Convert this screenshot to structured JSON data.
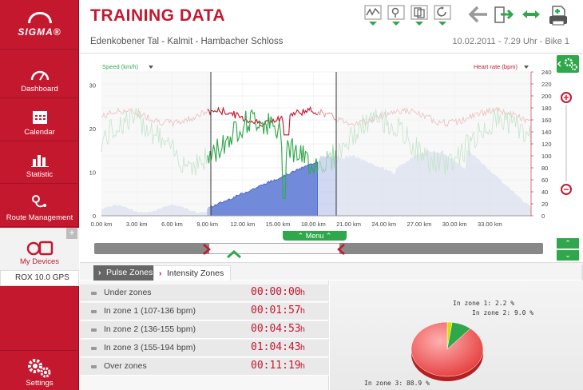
{
  "app": {
    "logo_text": "SIGMA®",
    "title": "TRAINING DATA"
  },
  "sidebar": {
    "items": [
      {
        "label": "Dashboard"
      },
      {
        "label": "Calendar"
      },
      {
        "label": "Statistic"
      },
      {
        "label": "Route Management"
      },
      {
        "label": "My Devices"
      },
      {
        "label": "Settings"
      }
    ],
    "add_label": "+",
    "device": "ROX 10.0 GPS"
  },
  "header": {
    "route": "Edenkobener Tal - Kalmit - Hambacher Schloss",
    "date_info": "10.02.2011 - 7.29 Uhr - Bike 1"
  },
  "chart": {
    "left_axis_label": "Speed (km/h)",
    "right_axis_label": "Heart rate (bpm)",
    "left_ticks": [
      "0",
      "10",
      "20",
      "30"
    ],
    "right_ticks": [
      "0",
      "20",
      "40",
      "60",
      "80",
      "100",
      "120",
      "140",
      "160",
      "180",
      "200",
      "220",
      "240"
    ],
    "x_ticks": [
      "0.00 km",
      "3.00 km",
      "6.00 km",
      "9.00 km",
      "12.00 km",
      "15.00 km",
      "18.00 km",
      "21.00 km",
      "24.00 km",
      "27.00 km",
      "30.00 km",
      "33.00 km"
    ],
    "menu_label": "Menu",
    "colors": {
      "speed": "#2ea84a",
      "heart": "#c4182f",
      "altitude": "#4a6bc8"
    }
  },
  "tabs": [
    {
      "label": "Pulse Zones"
    },
    {
      "label": "Intensity Zones"
    }
  ],
  "zones": [
    {
      "name": "Under zones",
      "time": "00:00:00",
      "unit": "h"
    },
    {
      "name": "In zone 1 (107-136 bpm)",
      "time": "00:01:57",
      "unit": "h"
    },
    {
      "name": "In zone 2 (136-155 bpm)",
      "time": "00:04:53",
      "unit": "h"
    },
    {
      "name": "In zone 3 (155-194 bpm)",
      "time": "01:04:43",
      "unit": "h"
    },
    {
      "name": "Over zones",
      "time": "00:11:19",
      "unit": "h"
    }
  ],
  "pie": {
    "labels": [
      "In zone 1: 2.2 %",
      "In zone 2: 9.0 %",
      "In zone 3: 88.9 %"
    ],
    "values": [
      2.2,
      9.0,
      88.9
    ],
    "colors": [
      "#d8e000",
      "#2ea84a",
      "#f05050"
    ]
  }
}
